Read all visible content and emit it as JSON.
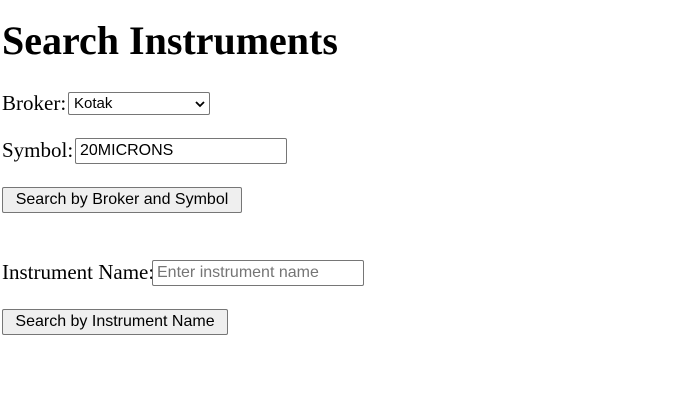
{
  "page": {
    "title": "Search Instruments"
  },
  "form": {
    "broker_label": "Broker:",
    "broker_selected": "Kotak",
    "symbol_label": "Symbol:",
    "symbol_value": "20MICRONS",
    "search_broker_symbol_label": "Search by Broker and Symbol",
    "instrument_name_label": "Instrument Name:",
    "instrument_name_value": "",
    "instrument_name_placeholder": "Enter instrument name",
    "search_name_label": "Search by Instrument Name"
  },
  "icons": {
    "select_chevron": "chevron-down-icon"
  }
}
